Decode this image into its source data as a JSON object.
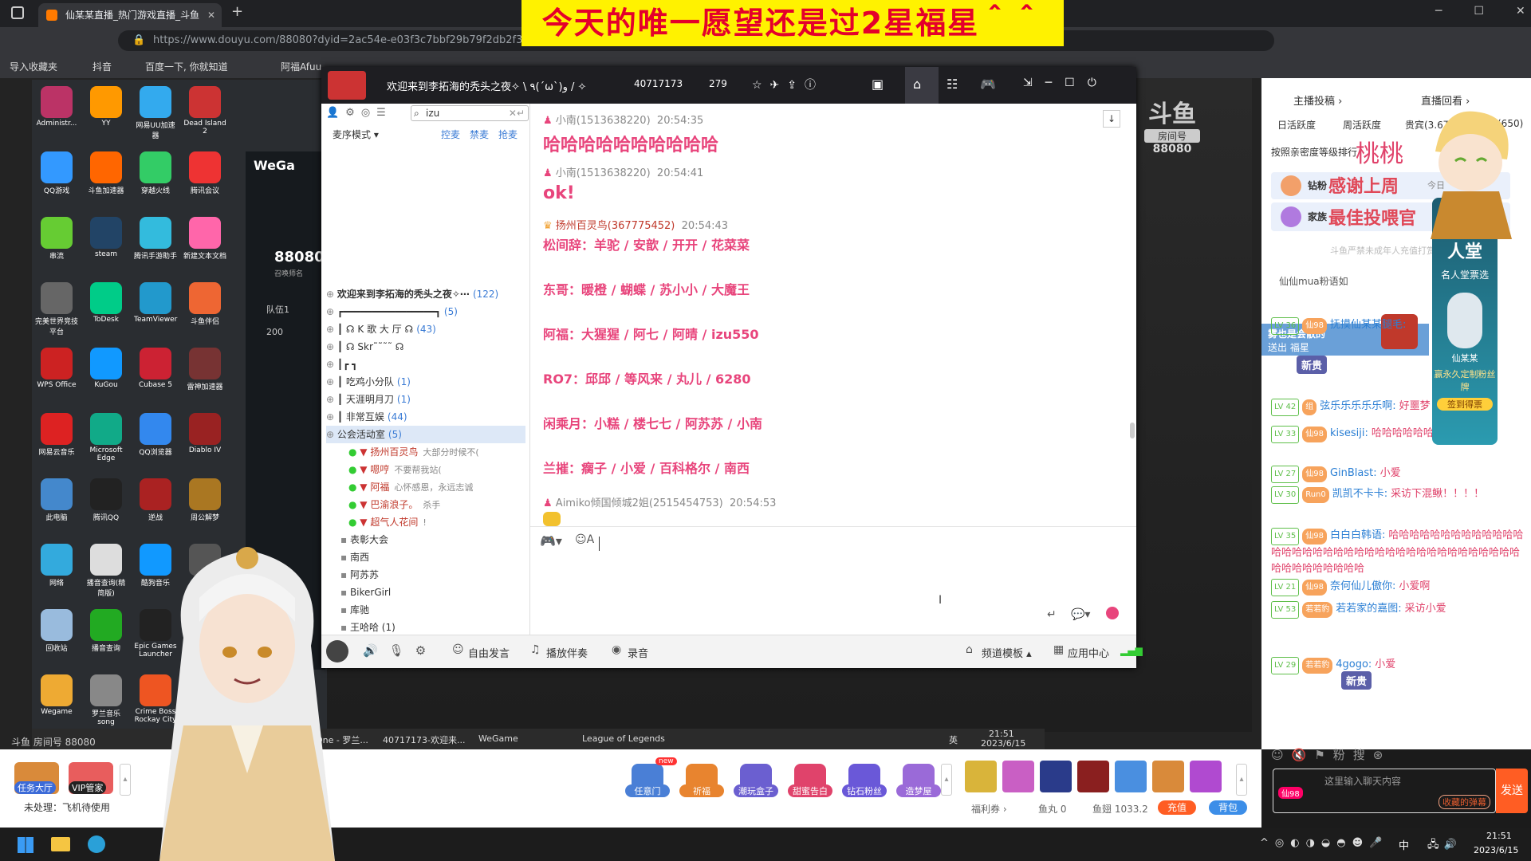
{
  "browser": {
    "tabs": [
      {
        "label": "仙某某直播_热门游戏直播_斗鱼"
      },
      {
        "label": "+"
      }
    ],
    "address": "https://www.douyu.com/88080?dyid=2ac54e-e03f3c7bbf29b79f2db2f3b",
    "bookmarks": [
      "导入收藏夹",
      "抖音",
      "百度一下, 你就知道",
      "阿福Afuu"
    ]
  },
  "banner": {
    "text": "今天的唯一愿望还是过2星福星＾＾"
  },
  "desktop": {
    "icons": [
      "Administr...",
      "YY",
      "网易UU加速器",
      "Dead Island 2",
      "QQ游戏",
      "斗鱼加速器",
      "穿越火线",
      "腾讯会议",
      "串流",
      "steam",
      "腾讯手游助手",
      "新建文本文档",
      "完美世界竞技平台",
      "ToDesk",
      "TeamViewer",
      "斗鱼伴侣",
      "WPS Office",
      "KuGou",
      "Cubase 5",
      "雷神加速器",
      "网易云音乐",
      "Microsoft Edge",
      "QQ浏览器",
      "Diablo IV",
      "此电脑",
      "腾讯QQ",
      "逆战",
      "周公解梦",
      "网络",
      "播音查询(精简版)",
      "酷狗音乐",
      "Logi",
      "回收站",
      "播音查询",
      "Epic Games Launcher",
      "",
      "Wegame",
      "罗兰音乐 song",
      "Crime Boss Rockay City",
      ""
    ],
    "wegame": {
      "logo": "WeGa",
      "room": "88080",
      "sub": "召唤师名",
      "team": "队伍1",
      "score": "200"
    }
  },
  "yy": {
    "title": "欢迎来到李拓海的秃头之夜✧ \\ ٩(ˊωˋ)و / ✧",
    "channel_id": "40717173",
    "online": "279",
    "search_value": "izu",
    "mode_label": "麦序模式 ▾",
    "mic_actions": [
      "控麦",
      "禁麦",
      "抢麦"
    ],
    "channels": [
      {
        "name": "欢迎来到李拓海的秃头之夜✧⋯",
        "count": "(122)"
      },
      {
        "name": "┏━━━━━━━━━━━━━━━━┓",
        "count": "(5)"
      },
      {
        "name": "┃  ☊ K 歌 大 厅 ☊",
        "count": "(43)"
      },
      {
        "name": "┃  ☊  Skr˜˜˜˜  ☊",
        "count": ""
      },
      {
        "name": "┃┏    ┓",
        "count": ""
      },
      {
        "name": "┃  吃鸡小分队",
        "count": "(1)"
      },
      {
        "name": "┃  天涯明月刀",
        "count": "(1)"
      },
      {
        "name": "┃  非常互娱",
        "count": "(44)"
      },
      {
        "name": "公会活动室",
        "count": "(5)"
      }
    ],
    "members": [
      {
        "name": "扬州百灵鸟",
        "note": "大部分时候不("
      },
      {
        "name": "嗯哼",
        "note": "不要帮我站("
      },
      {
        "name": "阿福",
        "note": "心怀感恩，永远志诚"
      },
      {
        "name": "巴渝浪子。",
        "note": "杀手"
      },
      {
        "name": "超气人花间",
        "note": "!"
      }
    ],
    "sub_channels": [
      "表彰大会",
      "南西",
      "阿苏苏",
      "BikerGirl",
      "库驰",
      "王哈哈 (1)",
      "邱邱"
    ],
    "room_badge": {
      "name": "斗鱼",
      "label": "房间号",
      "id": "88080"
    },
    "messages": {
      "m1_user": "小南(1513638220)",
      "m1_time": "20:54:35",
      "m1_text": "哈哈哈哈哈哈哈哈哈哈",
      "m2_user": "小南(1513638220)",
      "m2_time": "20:54:41",
      "m2_text": "ok!",
      "m3_user": "扬州百灵鸟(367775452)",
      "m3_time": "20:54:43",
      "m3_lines": [
        "松间辞：羊驼 / 安歆 / 开开 / 花菜菜",
        "东哥：暖橙 / 蝴蝶 / 苏小小 / 大魔王",
        "阿福：大猩猩 / 阿七 / 阿晴 / izu550",
        "RO7：邱邱 / 等风来 / 丸儿 / 6280",
        "闲乘月：小糕 / 楼七七 / 阿苏苏 / 小南",
        "兰摧：瘸子 / 小爱 / 百科格尔 / 南西"
      ],
      "m4_user": "Aimiko倾国倾城2姐(2515454753)",
      "m4_time": "20:54:53"
    },
    "bottom": [
      "自由发言",
      "播放伴奏",
      "录音",
      "频道模板 ▴",
      "应用中心"
    ]
  },
  "douyu": {
    "top_links": [
      "主播投稿 ›",
      "直播回看 ›"
    ],
    "rank_tabs": [
      "日活跃度",
      "周活跃度",
      "贵宾(3.6万)",
      "(650)"
    ],
    "rank_note": "按照亲密度等级排行",
    "peach": "桃桃",
    "thanks": "感谢上周",
    "banner2": "最佳投喂官",
    "diamond": "钻粉",
    "family": "家族",
    "today": "今日",
    "notice": "斗鱼严禁未成年人充值打赏",
    "notify": "仙仙mua粉语如",
    "hall": "斗鱼名人堂",
    "hall_sub": "名人堂票选",
    "vip_name": "仙某某",
    "vip_btn1": "赢永久定制粉丝牌",
    "vip_btn2": "签到得票",
    "gift_tip": "雾也是会散的",
    "gift_tip2": "送出  福星",
    "new_label": "新贵",
    "chat": [
      {
        "lv": "LV 36",
        "fan": "仙98",
        "user": "抚摸仙某某腿毛:",
        "text": ""
      },
      {
        "lv": "LV 42",
        "fan": "组",
        "user": "弦乐乐乐乐乐啊:",
        "text": "好噩梦"
      },
      {
        "lv": "LV 33",
        "fan": "仙98",
        "user": "kisesiji:",
        "text": "哈哈哈哈哈哈"
      },
      {
        "lv": "LV 27",
        "fan": "仙98",
        "user": "GinBlast:",
        "text": "小爱"
      },
      {
        "lv": "LV 30",
        "fan": "Run0",
        "user": "凯凯不卡卡:",
        "text": "采访下混鳅！！！！"
      },
      {
        "lv": "LV 35",
        "fan": "仙98",
        "user": "白白白韩语:",
        "text": "哈哈哈哈哈哈哈哈哈哈哈哈哈哈哈哈哈哈哈哈哈哈哈哈哈哈哈哈哈哈哈哈哈哈哈哈哈哈哈哈哈哈哈哈哈哈"
      },
      {
        "lv": "LV 21",
        "fan": "仙98",
        "user": "奈何仙儿傲你:",
        "text": "小爱啊"
      },
      {
        "lv": "LV 53",
        "fan": "若若豹",
        "user": "若若家的嘉图:",
        "text": "采访小爱"
      },
      {
        "lv": "LV 29",
        "fan": "若若豹",
        "user": "4gogo:",
        "text": "小爱"
      }
    ],
    "input_placeholder": "这里输入聊天内容",
    "send": "发送",
    "fan_tag": "仙98",
    "barrage_tag": "收藏的弹幕"
  },
  "giftbar": {
    "task": "任务大厅",
    "vip": "VIP管家",
    "status": "未处理：飞机待使用",
    "gifts": [
      "任意门",
      "祈福",
      "潮玩盒子",
      "甜蜜告白",
      "钻石粉丝",
      "造梦屋"
    ],
    "new_tag": "new",
    "wallet_label": "福利券 ›",
    "fish_ball": "鱼丸 0",
    "fish_fin": "鱼翅 1033.2",
    "recharge": "充值",
    "backpack": "背包"
  },
  "inner_taskbar": {
    "items": [
      "One - 罗兰...",
      "40717173-欢迎来...",
      "WeGame",
      "League of Legends"
    ],
    "time": "21:51",
    "date": "2023/6/15",
    "lang": "英"
  },
  "watermark": "斗鱼 房间号 88080",
  "taskbar": {
    "time": "21:51",
    "date": "2023/6/15",
    "lang": "中"
  }
}
